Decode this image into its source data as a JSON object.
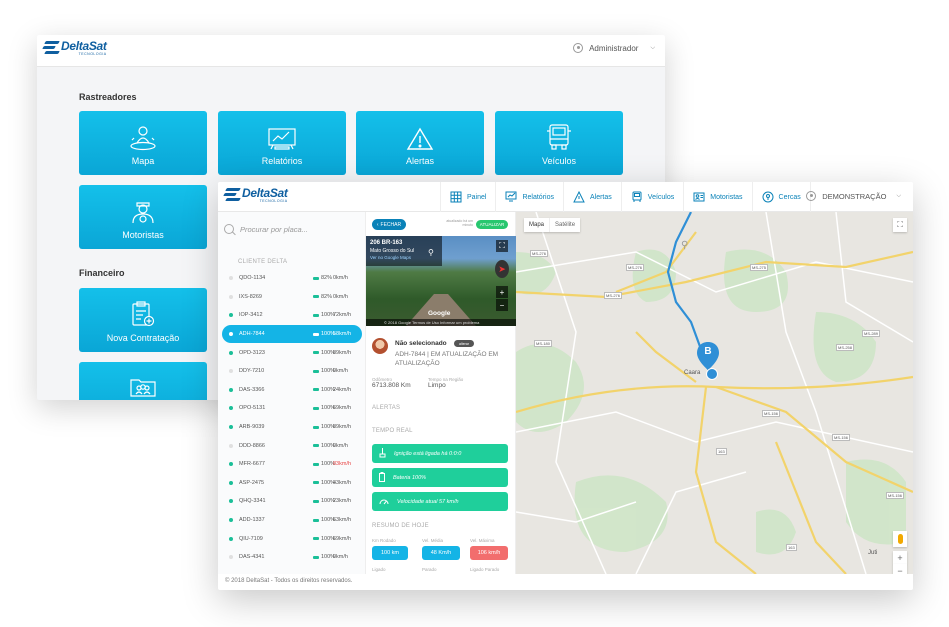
{
  "back": {
    "brand": "DeltaSat",
    "brand_sub": "TECNOLOGIA",
    "user": "Administrador",
    "section_trackers": "Rastreadores",
    "tiles": [
      {
        "label": "Mapa",
        "icon": "map-person-icon"
      },
      {
        "label": "Relatórios",
        "icon": "reports-icon"
      },
      {
        "label": "Alertas",
        "icon": "alert-icon"
      },
      {
        "label": "Veículos",
        "icon": "truck-icon"
      },
      {
        "label": "Motoristas",
        "icon": "driver-icon"
      }
    ],
    "section_finance": "Financeiro",
    "finance_tiles": [
      {
        "label": "Nova Contratação",
        "icon": "new-contract-icon"
      },
      {
        "label": "",
        "icon": "users-folder-icon"
      }
    ]
  },
  "front": {
    "brand": "DeltaSat",
    "brand_sub": "TECNOLOGIA",
    "nav": [
      {
        "label": "Painel",
        "icon": "dashboard-icon"
      },
      {
        "label": "Relatórios",
        "icon": "reports-icon"
      },
      {
        "label": "Alertas",
        "icon": "alert-icon"
      },
      {
        "label": "Veículos",
        "icon": "truck-icon"
      },
      {
        "label": "Motoristas",
        "icon": "driver-icon"
      },
      {
        "label": "Cercas",
        "icon": "fence-icon"
      }
    ],
    "user": "DEMONSTRAÇÃO",
    "search_placeholder": "Procurar por placa...",
    "client_label": "CLIENTE DELTA",
    "vehicles": [
      {
        "plate": "QDO-1134",
        "pct": "82%",
        "speed": "0km/h",
        "on": false,
        "sel": false,
        "alert": false
      },
      {
        "plate": "IXS-8269",
        "pct": "82%",
        "speed": "0km/h",
        "on": false,
        "sel": false,
        "alert": false
      },
      {
        "plate": "IOP-3412",
        "pct": "100%",
        "speed": "72km/h",
        "on": true,
        "sel": false,
        "alert": false
      },
      {
        "plate": "ADH-7844",
        "pct": "100%",
        "speed": "58km/h",
        "on": true,
        "sel": true,
        "alert": false
      },
      {
        "plate": "OPD-3123",
        "pct": "100%",
        "speed": "89km/h",
        "on": true,
        "sel": false,
        "alert": false
      },
      {
        "plate": "DDY-7210",
        "pct": "100%",
        "speed": "0km/h",
        "on": false,
        "sel": false,
        "alert": false
      },
      {
        "plate": "DAS-3366",
        "pct": "100%",
        "speed": "24km/h",
        "on": true,
        "sel": false,
        "alert": false
      },
      {
        "plate": "OPO-5131",
        "pct": "100%",
        "speed": "69km/h",
        "on": true,
        "sel": false,
        "alert": false
      },
      {
        "plate": "ARB-9039",
        "pct": "100%",
        "speed": "89km/h",
        "on": true,
        "sel": false,
        "alert": false
      },
      {
        "plate": "DDD-8866",
        "pct": "100%",
        "speed": "0km/h",
        "on": false,
        "sel": false,
        "alert": false
      },
      {
        "plate": "MFR-6677",
        "pct": "100%",
        "speed": "83km/h",
        "on": true,
        "sel": false,
        "alert": true
      },
      {
        "plate": "ASP-2475",
        "pct": "100%",
        "speed": "43km/h",
        "on": true,
        "sel": false,
        "alert": false
      },
      {
        "plate": "QHQ-3341",
        "pct": "100%",
        "speed": "23km/h",
        "on": true,
        "sel": false,
        "alert": false
      },
      {
        "plate": "ADD-1337",
        "pct": "100%",
        "speed": "63km/h",
        "on": true,
        "sel": false,
        "alert": false
      },
      {
        "plate": "QIU-7109",
        "pct": "100%",
        "speed": "69km/h",
        "on": true,
        "sel": false,
        "alert": false
      },
      {
        "plate": "DAS-4341",
        "pct": "100%",
        "speed": "0km/h",
        "on": false,
        "sel": false,
        "alert": false
      }
    ],
    "footer": "© 2018 DeltaSat - Todos os direitos reservados.",
    "panel": {
      "close_label": "FECHAR",
      "updated_note": "atualizado há um minuto",
      "update_label": "ATUALIZAR",
      "street": {
        "road": "206 BR-163",
        "state": "Mato Grosso do Sul",
        "link": "Ver no Google Maps",
        "logo": "Google",
        "bar": "© 2018 Google   Termos de Uso   Informar um problema"
      },
      "driver_name": "Não selecionado",
      "change_label": "alterar",
      "driver_status": "ADH-7844 | EM ATUALIZAÇÃO EM ATUALIZAÇÃO",
      "odometer_label": "Odômetro",
      "odometer_value": "6713.808 Km",
      "weather_label": "Tempo na Região",
      "weather_value": "Limpo",
      "alerts_heading": "ALERTAS",
      "realtime_heading": "TEMPO REAL",
      "realtime": [
        {
          "text": "Ignição está ligada há 0:0:0",
          "icon": "ignition-icon"
        },
        {
          "text": "Bateria 100%",
          "icon": "battery-icon"
        },
        {
          "text": "Velocidade atual 57 km/h",
          "icon": "speedometer-icon"
        }
      ],
      "summary_heading": "RESUMO DE HOJE",
      "summary": [
        {
          "label": "Km Rodado",
          "value": "100 km",
          "color": "#14b4e6"
        },
        {
          "label": "Vel. Média",
          "value": "48 Km/h",
          "color": "#14b4e6"
        },
        {
          "label": "Vel. Máxima",
          "value": "106 km/h",
          "color": "#f26d6d"
        }
      ],
      "bottom_labels": [
        "Ligado",
        "Parado",
        "Ligado Parado"
      ]
    },
    "map": {
      "tab_map": "Mapa",
      "tab_sat": "Satélite",
      "marker": "B",
      "town": "Caara",
      "town2": "Juti",
      "roads": [
        "MS-276",
        "MS-276",
        "MS-275",
        "MS-276",
        "MS-180",
        "MS-289",
        "MS-156",
        "MS-156",
        "MS-156",
        "163",
        "163",
        "MS-258"
      ]
    },
    "colors": {
      "accent": "#14b4e6",
      "nav": "#0a82b8",
      "green": "#1fcf9b",
      "red": "#f26d6d"
    }
  }
}
